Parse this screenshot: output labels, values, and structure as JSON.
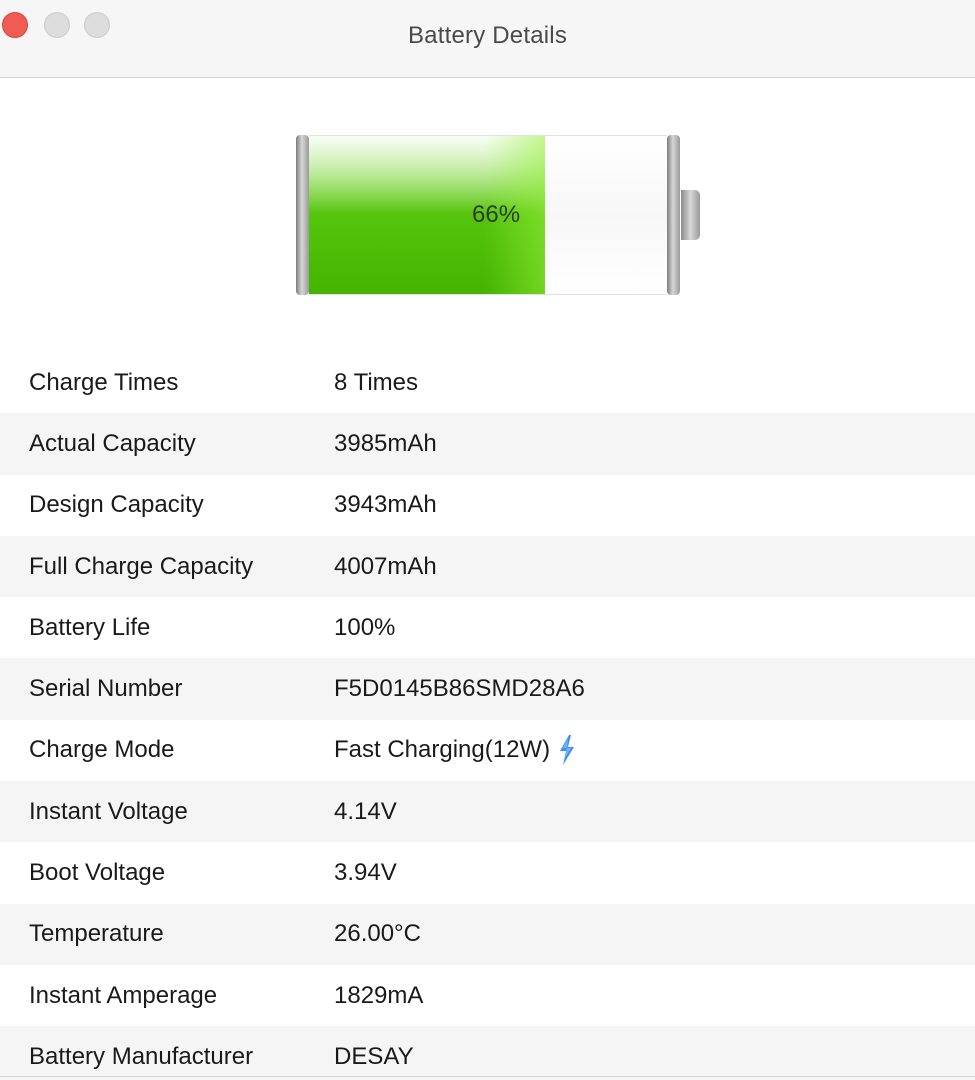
{
  "window": {
    "title": "Battery Details"
  },
  "battery": {
    "percent_label": "66%",
    "level": 0.66,
    "fill_color": "#5bc713"
  },
  "details": [
    {
      "label": "Charge Times",
      "value": "8 Times"
    },
    {
      "label": "Actual Capacity",
      "value": "3985mAh"
    },
    {
      "label": "Design Capacity",
      "value": "3943mAh"
    },
    {
      "label": "Full Charge Capacity",
      "value": "4007mAh"
    },
    {
      "label": "Battery Life",
      "value": "100%"
    },
    {
      "label": "Serial Number",
      "value": "F5D0145B86SMD28A6"
    },
    {
      "label": "Charge Mode",
      "value": "Fast Charging(12W)",
      "icon": "lightning-bolt-icon"
    },
    {
      "label": "Instant Voltage",
      "value": "4.14V"
    },
    {
      "label": "Boot Voltage",
      "value": "3.94V"
    },
    {
      "label": "Temperature",
      "value": "26.00°C"
    },
    {
      "label": "Instant Amperage",
      "value": "1829mA"
    },
    {
      "label": "Battery Manufacturer",
      "value": "DESAY"
    }
  ],
  "colors": {
    "close_button": "#ee5c53",
    "bolt": "#3f8ff0",
    "row_alt": "#f5f5f5"
  }
}
